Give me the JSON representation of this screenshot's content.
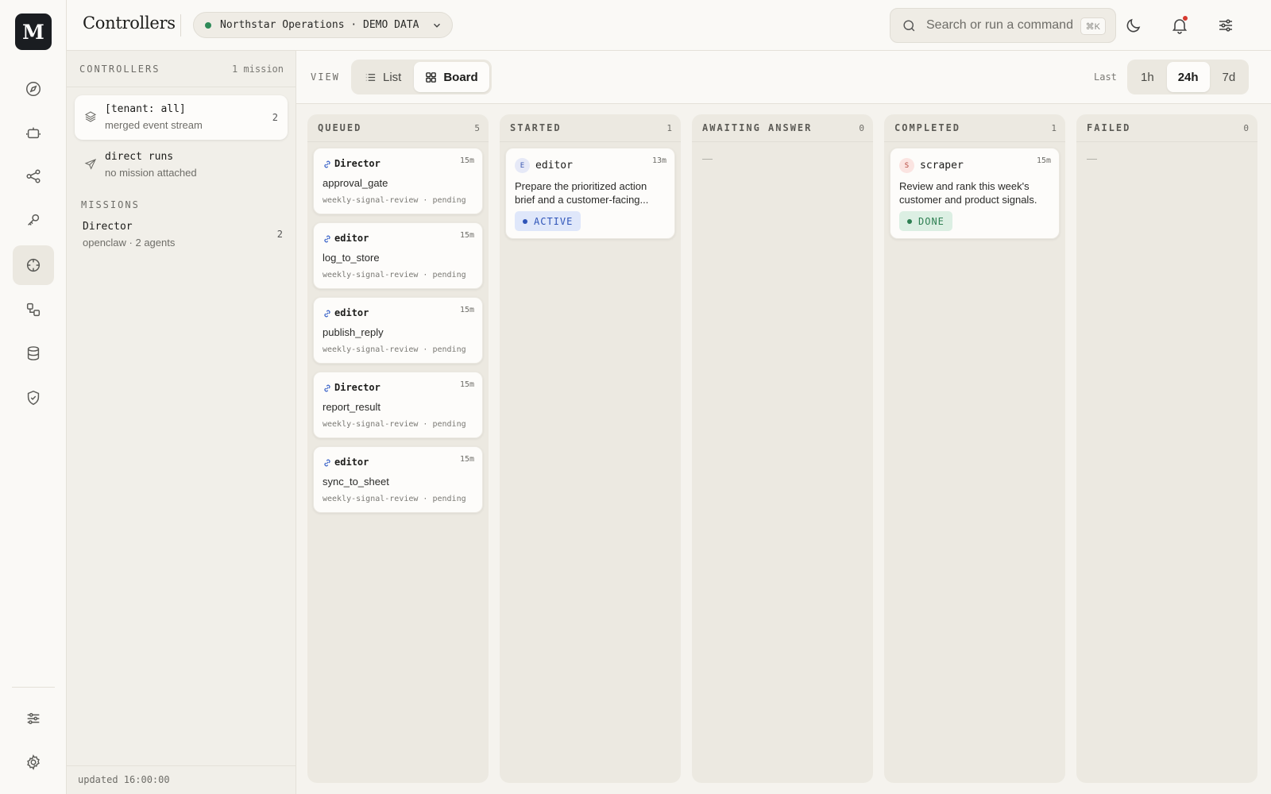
{
  "app": {
    "logo_letter": "M",
    "page_title": "Controllers",
    "tenant": "Northstar Operations · DEMO DATA",
    "search_placeholder": "Search or run a command",
    "search_shortcut": "⌘K"
  },
  "rail": {
    "items": [
      {
        "icon": "compass-icon"
      },
      {
        "icon": "bot-icon"
      },
      {
        "icon": "share-icon"
      },
      {
        "icon": "key-icon"
      },
      {
        "icon": "crosshair-icon",
        "active": true
      },
      {
        "icon": "flow-icon"
      },
      {
        "icon": "database-icon"
      },
      {
        "icon": "shield-check-icon"
      }
    ],
    "bottom": [
      {
        "icon": "sliders-icon"
      },
      {
        "icon": "settings-gear-icon"
      }
    ]
  },
  "sidepanel": {
    "heading": "CONTROLLERS",
    "count": "1 mission",
    "controllers": [
      {
        "title": "[tenant: all]",
        "subtitle": "merged event stream",
        "count": "2",
        "icon": "layers-icon",
        "selected": true
      },
      {
        "title": "direct runs",
        "subtitle": "no mission attached",
        "count": "",
        "icon": "send-icon",
        "selected": false
      }
    ],
    "missions_heading": "MISSIONS",
    "missions": [
      {
        "title": "Director",
        "subtitle": "openclaw · 2 agents",
        "count": "2"
      }
    ],
    "footer": "updated 16:00:00"
  },
  "viewbar": {
    "view_label": "VIEW",
    "views": [
      {
        "label": "List"
      },
      {
        "label": "Board",
        "active": true
      }
    ],
    "last_label": "Last",
    "ranges": [
      {
        "label": "1h"
      },
      {
        "label": "24h",
        "active": true
      },
      {
        "label": "7d"
      }
    ]
  },
  "board": {
    "columns": [
      {
        "title": "QUEUED",
        "count": "5",
        "cards": [
          {
            "agent": "Director",
            "time": "15m",
            "tool": "approval_gate",
            "meta": "weekly-signal-review · pending"
          },
          {
            "agent": "editor",
            "time": "15m",
            "tool": "log_to_store",
            "meta": "weekly-signal-review · pending"
          },
          {
            "agent": "editor",
            "time": "15m",
            "tool": "publish_reply",
            "meta": "weekly-signal-review · pending"
          },
          {
            "agent": "Director",
            "time": "15m",
            "tool": "report_result",
            "meta": "weekly-signal-review · pending"
          },
          {
            "agent": "editor",
            "time": "15m",
            "tool": "sync_to_sheet",
            "meta": "weekly-signal-review · pending"
          }
        ]
      },
      {
        "title": "STARTED",
        "count": "1",
        "runs": [
          {
            "avatar": "E",
            "agent": "editor",
            "time": "13m",
            "description": "Prepare the prioritized action brief and a customer-facing...",
            "status": "ACTIVE"
          }
        ]
      },
      {
        "title": "AWAITING ANSWER",
        "count": "0",
        "empty": "—"
      },
      {
        "title": "COMPLETED",
        "count": "1",
        "runs": [
          {
            "avatar": "S",
            "agent": "scraper",
            "time": "15m",
            "description": "Review and rank this week's customer and product signals.",
            "status": "DONE"
          }
        ]
      },
      {
        "title": "FAILED",
        "count": "0",
        "empty": "—"
      }
    ]
  },
  "colors": {
    "accent_blue": "#3a63c9",
    "status_active_bg": "#dfe7fa",
    "status_done_bg": "#dcefe3",
    "status_done_fg": "#2e7f52",
    "notification": "#d63a2f"
  }
}
